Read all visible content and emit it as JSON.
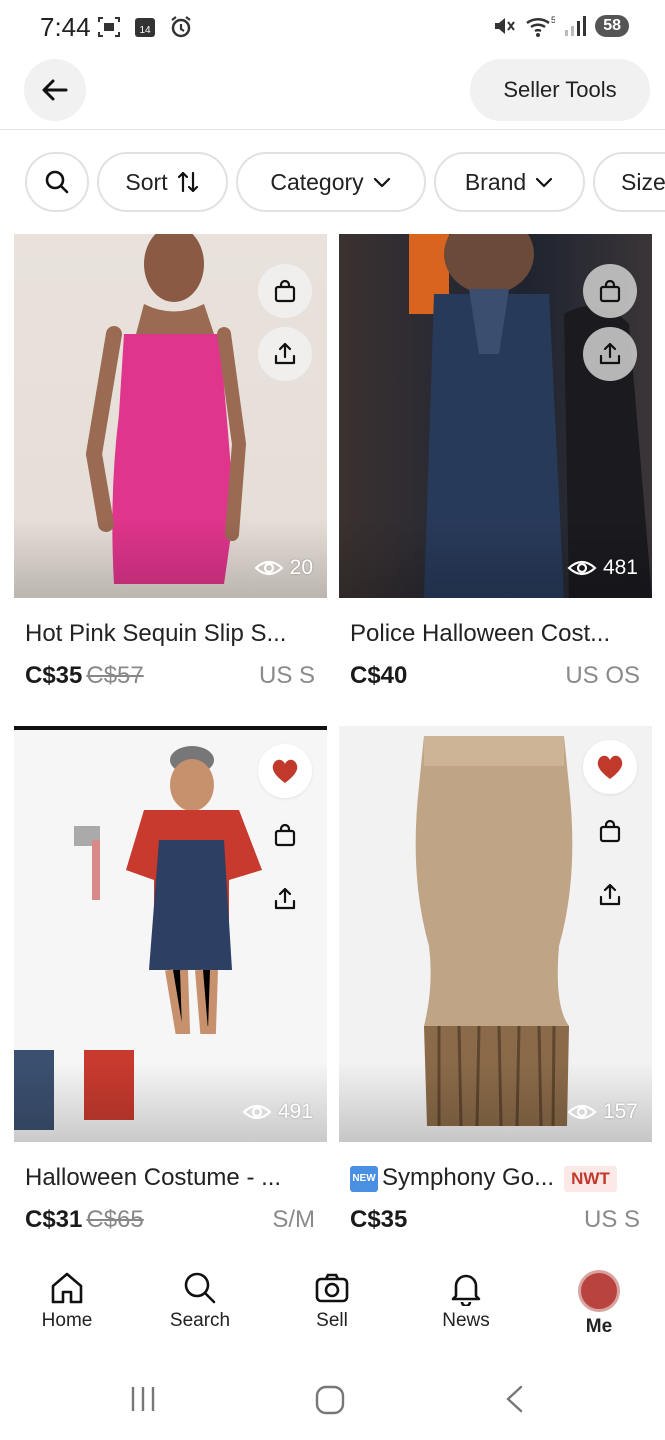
{
  "status_bar": {
    "time": "7:44",
    "calendar_day": "14",
    "battery": "58",
    "wifi_band": "5"
  },
  "app_bar": {
    "seller_tools_label": "Seller Tools"
  },
  "filters": {
    "sort_label": "Sort",
    "category_label": "Category",
    "brand_label": "Brand",
    "size_label": "Size"
  },
  "listings": [
    {
      "title": "Hot Pink Sequin Slip S...",
      "price": "C$35",
      "original_price": "C$57",
      "size": "US S",
      "views": "20",
      "liked": false
    },
    {
      "title": "Police Halloween Cost...",
      "price": "C$40",
      "original_price": "",
      "size": "US OS",
      "views": "481",
      "liked": false
    },
    {
      "title": "Halloween Costume - ...",
      "price": "C$31",
      "original_price": "C$65",
      "size": "S/M",
      "views": "491",
      "liked": true
    },
    {
      "title": "Symphony Go...",
      "price": "C$35",
      "original_price": "",
      "size": "US S",
      "views": "157",
      "liked": true,
      "new_tag": "NEW",
      "badge": "NWT"
    }
  ],
  "bottom_nav": {
    "home": "Home",
    "search": "Search",
    "sell": "Sell",
    "news": "News",
    "me": "Me"
  },
  "colors": {
    "heart": "#c0392b",
    "nwt_bg": "#fde8e8",
    "chip_border": "#e1e1e1",
    "avatar": "#b8433f"
  }
}
